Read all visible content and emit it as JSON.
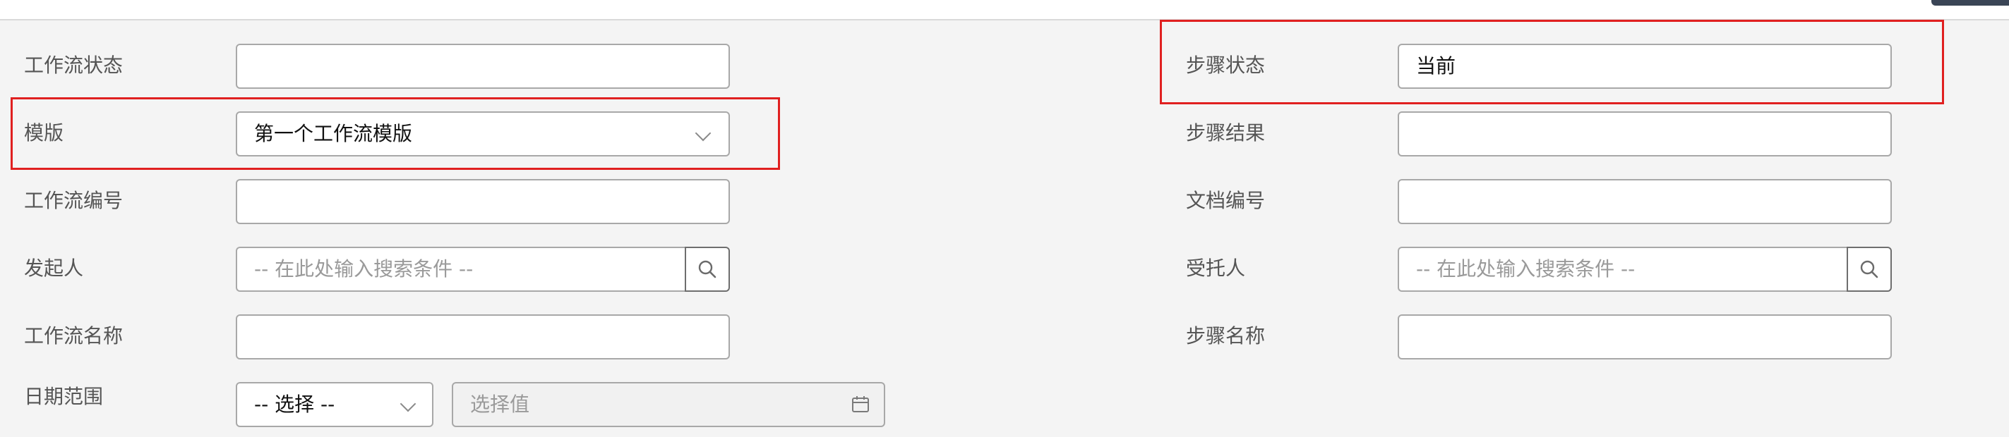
{
  "form": {
    "left": {
      "workflow_status": {
        "label": "工作流状态",
        "value": ""
      },
      "template": {
        "label": "模版",
        "value": "第一个工作流模版"
      },
      "workflow_number": {
        "label": "工作流编号",
        "value": ""
      },
      "initiator": {
        "label": "发起人",
        "placeholder": "-- 在此处输入搜索条件 --"
      },
      "workflow_name": {
        "label": "工作流名称",
        "value": ""
      },
      "date_range": {
        "label": "日期范围",
        "select_value": "-- 选择 --",
        "date_placeholder": "选择值"
      }
    },
    "right": {
      "step_status": {
        "label": "步骤状态",
        "value": "当前"
      },
      "step_result": {
        "label": "步骤结果",
        "value": ""
      },
      "document_number": {
        "label": "文档编号",
        "value": ""
      },
      "assignee": {
        "label": "受托人",
        "placeholder": "-- 在此处输入搜索条件 --"
      },
      "step_name": {
        "label": "步骤名称",
        "value": ""
      }
    }
  },
  "icons": {
    "search": "search-icon",
    "chevron": "chevron-down-icon",
    "calendar": "calendar-icon"
  },
  "colors": {
    "highlight_border": "#e02020",
    "field_border": "#a8a8a8",
    "background": "#f4f4f4"
  }
}
